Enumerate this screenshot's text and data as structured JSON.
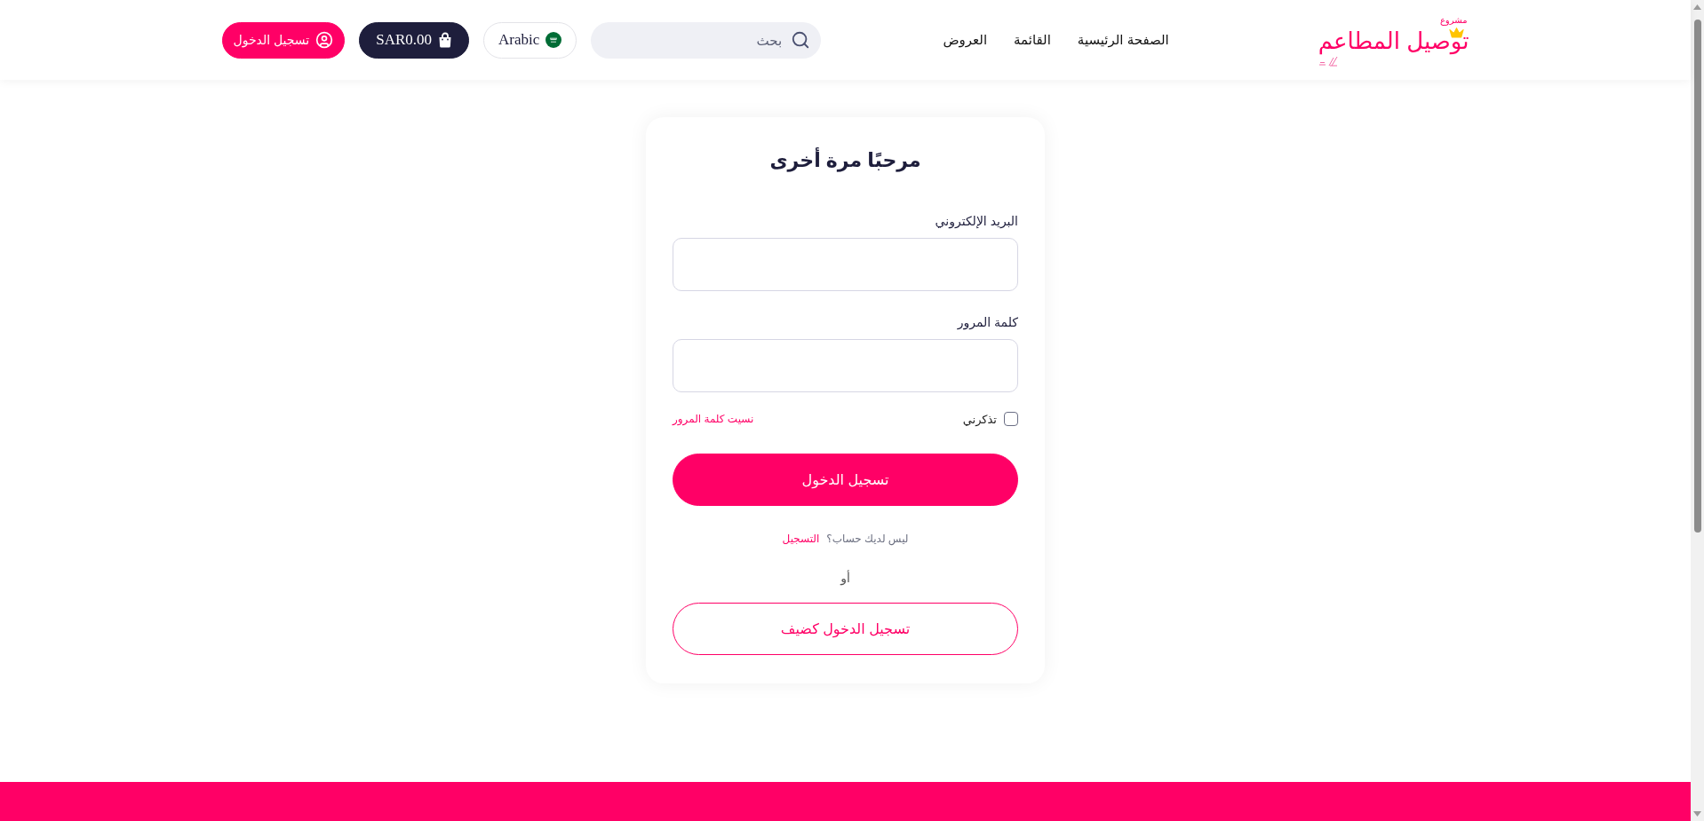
{
  "header": {
    "logo": {
      "kicker": "مشروع",
      "name": "توصيل المطاعم"
    },
    "nav": [
      {
        "label": "الصفحة الرئيسية"
      },
      {
        "label": "القائمة"
      },
      {
        "label": "العروض"
      }
    ],
    "search": {
      "placeholder": "بحث"
    },
    "language": {
      "label": "Arabic"
    },
    "cart": {
      "total": "SAR0.00"
    },
    "login_button": {
      "label": "تسجيل الدخول"
    }
  },
  "login_card": {
    "title": "مرحبًا مرة أخرى",
    "fields": [
      {
        "label": "البريد الإلكتروني"
      },
      {
        "label": "كلمة المرور"
      }
    ],
    "remember_me": {
      "label": "تذكرني",
      "checked": false
    },
    "forgot_link": "نسيت كلمة المرور",
    "submit_button": "تسجيل الدخول",
    "signup_prompt": {
      "text": "ليس لديك حساب؟",
      "link": "التسجيل"
    },
    "divider_text": "أو",
    "guest_button": "تسجيل الدخول كضيف"
  }
}
